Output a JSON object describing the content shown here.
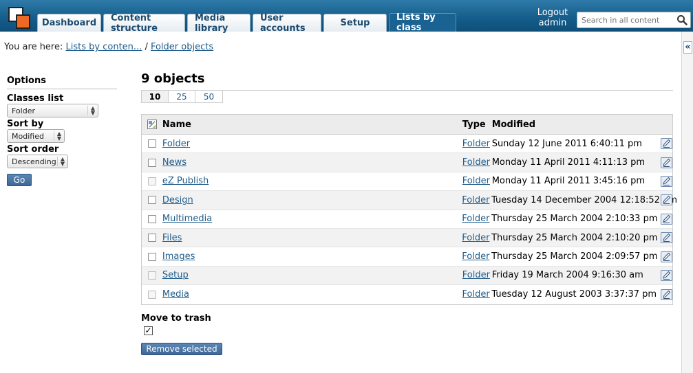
{
  "header": {
    "tabs": [
      {
        "label": "Dashboard",
        "active": false
      },
      {
        "label": "Content structure",
        "active": false
      },
      {
        "label": "Media library",
        "active": false
      },
      {
        "label": "User accounts",
        "active": false
      },
      {
        "label": "Setup",
        "active": false
      },
      {
        "label": "Lists by class",
        "active": true
      }
    ],
    "logout_line1": "Logout",
    "logout_line2": "admin",
    "search_placeholder": "Search in all content",
    "colors": {
      "bar": "#145c8a",
      "logo_accent": "#ee6a24"
    }
  },
  "breadcrumb": {
    "prefix": "You are here:",
    "items": [
      "Lists by conten...",
      "Folder objects"
    ],
    "separator": "/"
  },
  "options": {
    "title": "Options",
    "classes_label": "Classes list",
    "classes_value": "Folder",
    "sort_by_label": "Sort by",
    "sort_by_value": "Modified",
    "sort_order_label": "Sort order",
    "sort_order_value": "Descending",
    "go_label": "Go"
  },
  "main": {
    "title": "9 objects",
    "page_sizes": [
      "10",
      "25",
      "50"
    ],
    "current_page_size": "10",
    "columns": {
      "name": "Name",
      "type": "Type",
      "modified": "Modified"
    },
    "rows": [
      {
        "name": "Folder",
        "type": "Folder",
        "modified": "Sunday 12 June 2011 6:40:11 pm",
        "checkable": true
      },
      {
        "name": "News",
        "type": "Folder",
        "modified": "Monday 11 April 2011 4:11:13 pm",
        "checkable": true
      },
      {
        "name": "eZ Publish",
        "type": "Folder",
        "modified": "Monday 11 April 2011 3:45:16 pm",
        "checkable": false
      },
      {
        "name": "Design",
        "type": "Folder",
        "modified": "Tuesday 14 December 2004 12:18:52 pm",
        "checkable": true
      },
      {
        "name": "Multimedia",
        "type": "Folder",
        "modified": "Thursday 25 March 2004 2:10:33 pm",
        "checkable": true
      },
      {
        "name": "Files",
        "type": "Folder",
        "modified": "Thursday 25 March 2004 2:10:20 pm",
        "checkable": true
      },
      {
        "name": "Images",
        "type": "Folder",
        "modified": "Thursday 25 March 2004 2:09:57 pm",
        "checkable": true
      },
      {
        "name": "Setup",
        "type": "Folder",
        "modified": "Friday 19 March 2004 9:16:30 am",
        "checkable": false
      },
      {
        "name": "Media",
        "type": "Folder",
        "modified": "Tuesday 12 August 2003 3:37:37 pm",
        "checkable": false
      }
    ],
    "move_to_trash_label": "Move to trash",
    "move_to_trash_checked": true,
    "remove_label": "Remove selected"
  }
}
